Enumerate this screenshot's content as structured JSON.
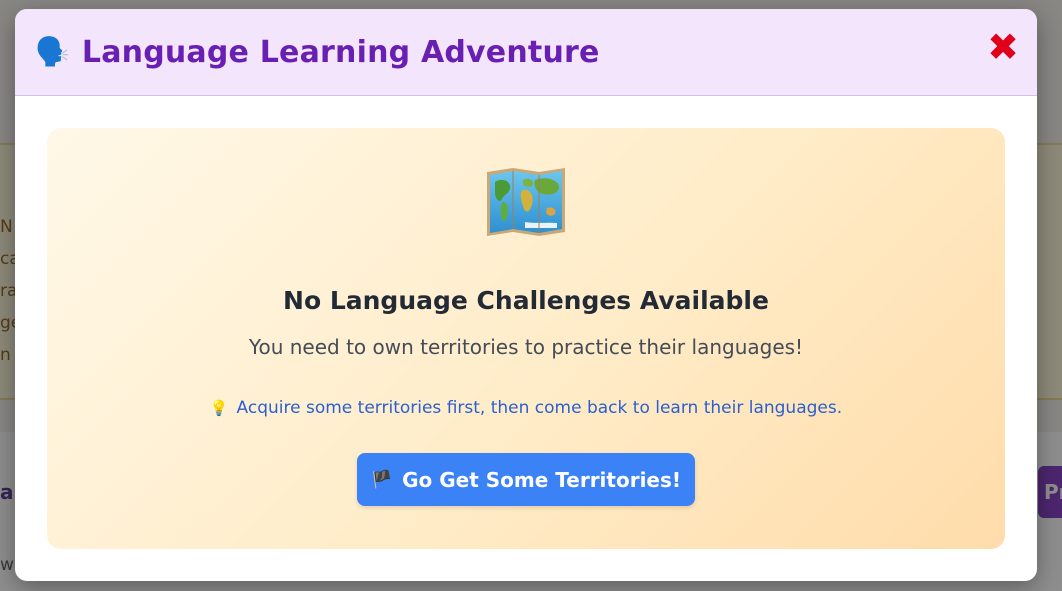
{
  "modal": {
    "header_icon": "speaking-head-icon",
    "header_emoji": "🗣️",
    "title": "Language Learning Adventure",
    "close_glyph": "✖",
    "close_icon": "close-icon",
    "empty_state": {
      "icon": "world-map-icon",
      "title": "No Language Challenges Available",
      "description": "You need to own territories to practice their languages!",
      "hint_icon": "light-bulb-icon",
      "hint_emoji": "💡",
      "hint": "Acquire some territories first, then come back to learn their languages.",
      "cta_icon": "black-flag-icon",
      "cta_emoji": "🏴",
      "cta_label": "Go Get Some Territories!"
    }
  },
  "background": {
    "left_fragments": [
      "N",
      "ca",
      "ra",
      "ge",
      "n"
    ],
    "bottom_left_fragment": "ar",
    "bottom_right_button": "Pr",
    "bottom_w": "w"
  },
  "colors": {
    "header_bg": "#f3e5fc",
    "title": "#6a1fb3",
    "close": "#e0001a",
    "cta_bg": "#3b82f6",
    "hint": "#2a5fd0"
  }
}
